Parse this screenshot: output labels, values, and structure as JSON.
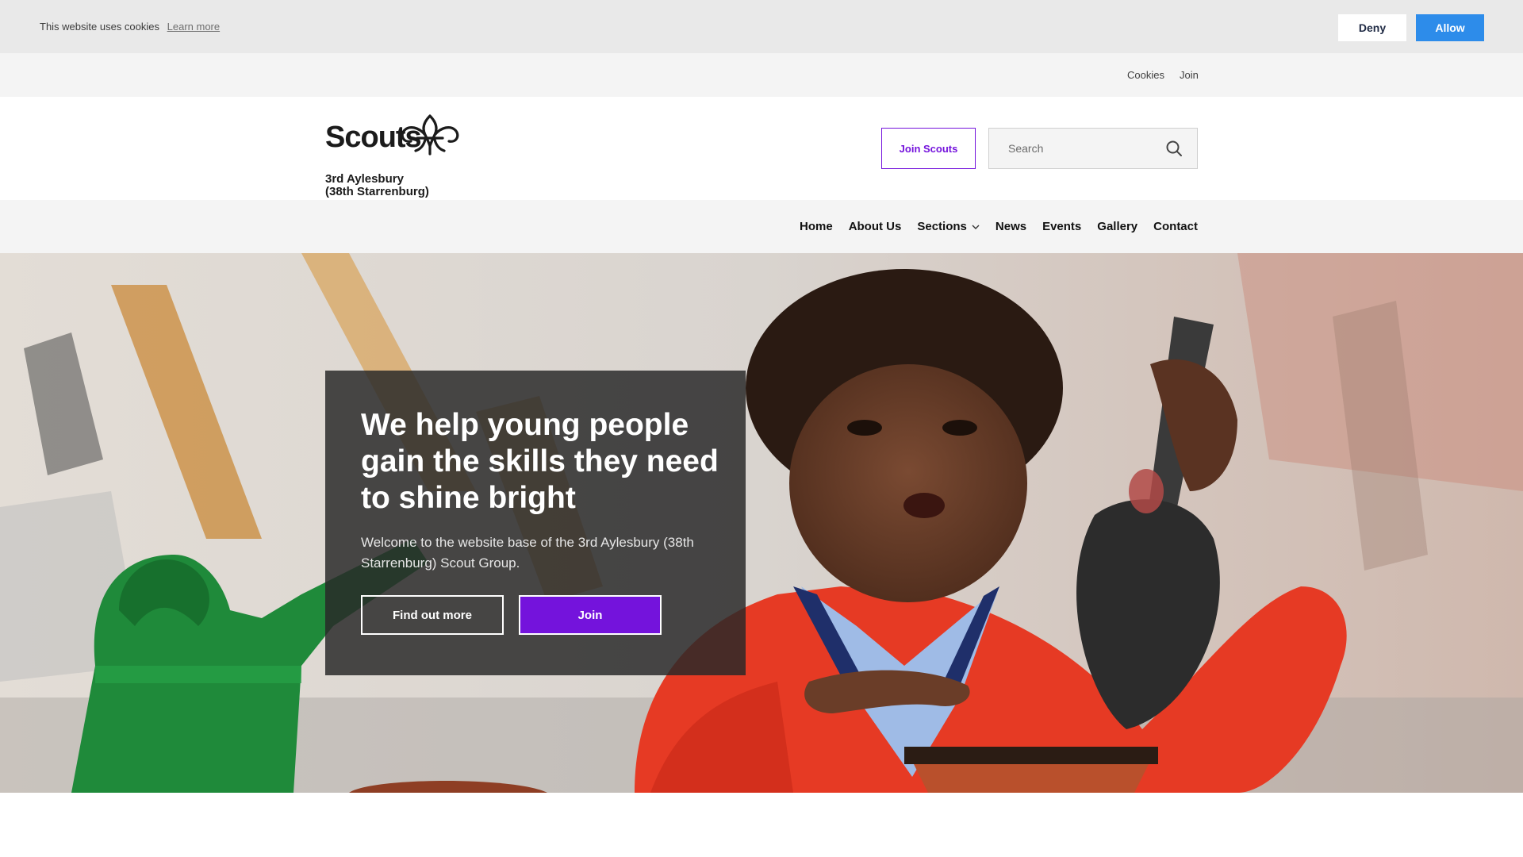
{
  "cookie_banner": {
    "message": "This website uses cookies",
    "learn_more": "Learn more",
    "deny": "Deny",
    "allow": "Allow",
    "allow_color": "#2d8cea"
  },
  "utility_nav": {
    "items": [
      "Cookies",
      "Join"
    ]
  },
  "header": {
    "logo_word": "Scouts",
    "logo_icon": "fleur-de-lis-icon",
    "group_name_line1": "3rd Aylesbury",
    "group_name_line2": "(38th Starrenburg)",
    "join_button": "Join Scouts",
    "search_placeholder": "Search",
    "brand_color": "#7413dc"
  },
  "main_nav": {
    "items": [
      "Home",
      "About Us",
      "Sections",
      "News",
      "Events",
      "Gallery",
      "Contact"
    ]
  },
  "hero": {
    "title": "We help young people gain the skills they need to shine bright",
    "text": "Welcome to the website base of the 3rd Aylesbury (38th Starrenburg) Scout Group.",
    "find_out_more": "Find out more",
    "join": "Join"
  }
}
